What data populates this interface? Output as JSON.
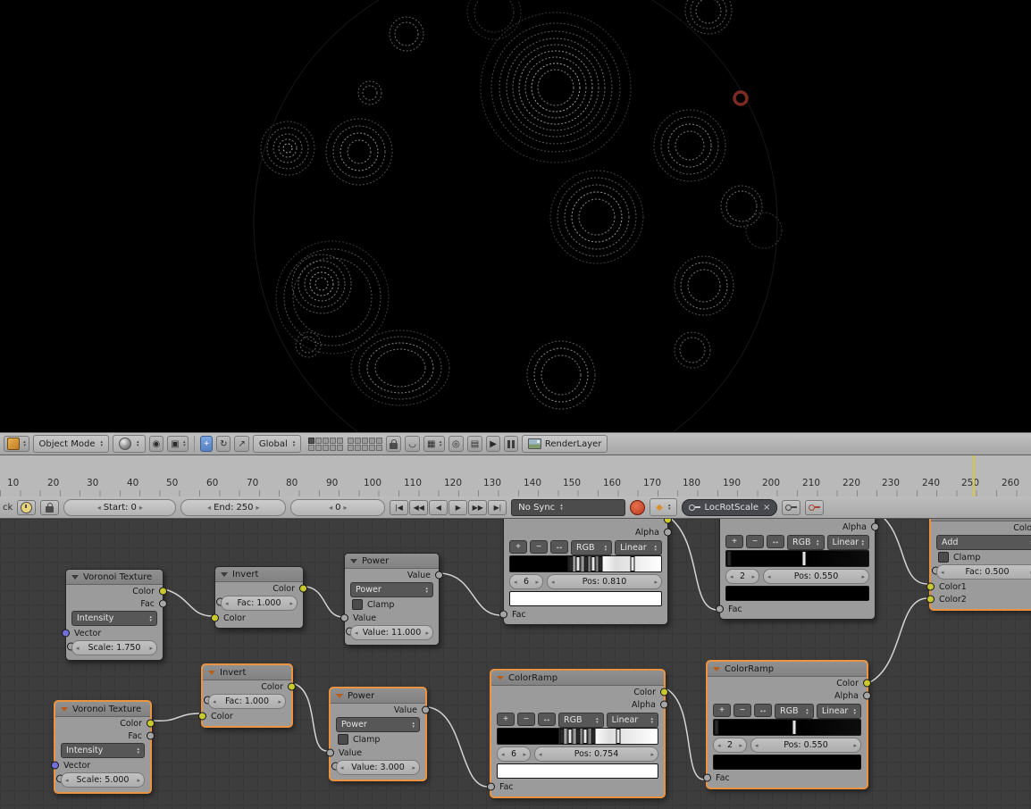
{
  "header3d": {
    "mode": "Object Mode",
    "orientation": "Global",
    "renderlayer": "RenderLayer"
  },
  "ruler": {
    "ticks": [
      "10",
      "20",
      "30",
      "40",
      "50",
      "60",
      "70",
      "80",
      "90",
      "100",
      "110",
      "120",
      "130",
      "140",
      "150",
      "160",
      "170",
      "180",
      "190",
      "200",
      "210",
      "220",
      "230",
      "240",
      "250",
      "260"
    ]
  },
  "timeline": {
    "clipped_label": "ck",
    "start": "Start:",
    "start_value": "0",
    "end": "End:",
    "end_value": "250",
    "frame": "0",
    "sync": "No Sync",
    "keying_set": "LocRotScale",
    "clear_icon": "×",
    "keying_diamond": "◆"
  },
  "transport": {
    "jump_start": "|◀",
    "prev_key": "◀◀",
    "play_rev": "◀",
    "play": "▶",
    "next_key": "▶▶",
    "jump_end": "▶|"
  },
  "nodes": {
    "voronoi_top": {
      "title": "Voronoi Texture",
      "out_color": "Color",
      "out_fac": "Fac",
      "coloring": "Intensity",
      "in_vector": "Vector",
      "scale": "Scale: 1.750"
    },
    "invert_top": {
      "title": "Invert",
      "out_color": "Color",
      "fac": "Fac: 1.000",
      "in_color": "Color"
    },
    "power_top": {
      "title": "Power",
      "out_value": "Value",
      "operation": "Power",
      "clamp": "Clamp",
      "in_value": "Value",
      "value": "Value: 11.000"
    },
    "ramp_top1": {
      "out_alpha": "Alpha",
      "add": "+",
      "sub": "−",
      "flip": "↔",
      "mode": "RGB",
      "interp": "Linear",
      "index": "6",
      "pos": "Pos: 0.810",
      "in_fac": "Fac"
    },
    "ramp_top2": {
      "out_alpha": "Alpha",
      "add": "+",
      "sub": "−",
      "flip": "↔",
      "mode": "RGB",
      "interp": "Linear",
      "index": "2",
      "pos": "Pos: 0.550",
      "in_fac": "Fac"
    },
    "mix": {
      "out_color": "Color",
      "blend": "Add",
      "clamp": "Clamp",
      "fac": "Fac: 0.500",
      "in_color1": "Color1",
      "in_color2": "Color2"
    },
    "voronoi_bot": {
      "title": "Voronoi Texture",
      "out_color": "Color",
      "out_fac": "Fac",
      "coloring": "Intensity",
      "in_vector": "Vector",
      "scale": "Scale: 5.000"
    },
    "invert_bot": {
      "title": "Invert",
      "out_color": "Color",
      "fac": "Fac: 1.000",
      "in_color": "Color"
    },
    "power_bot": {
      "title": "Power",
      "out_value": "Value",
      "operation": "Power",
      "clamp": "Clamp",
      "in_value": "Value",
      "value": "Value: 3.000"
    },
    "ramp_bot1": {
      "title": "ColorRamp",
      "out_color": "Color",
      "out_alpha": "Alpha",
      "add": "+",
      "sub": "−",
      "flip": "↔",
      "mode": "RGB",
      "interp": "Linear",
      "index": "6",
      "pos": "Pos: 0.754",
      "in_fac": "Fac"
    },
    "ramp_bot2": {
      "title": "ColorRamp",
      "out_color": "Color",
      "out_alpha": "Alpha",
      "add": "+",
      "sub": "−",
      "flip": "↔",
      "mode": "RGB",
      "interp": "Linear",
      "index": "2",
      "pos": "Pos: 0.550",
      "in_fac": "Fac"
    }
  }
}
